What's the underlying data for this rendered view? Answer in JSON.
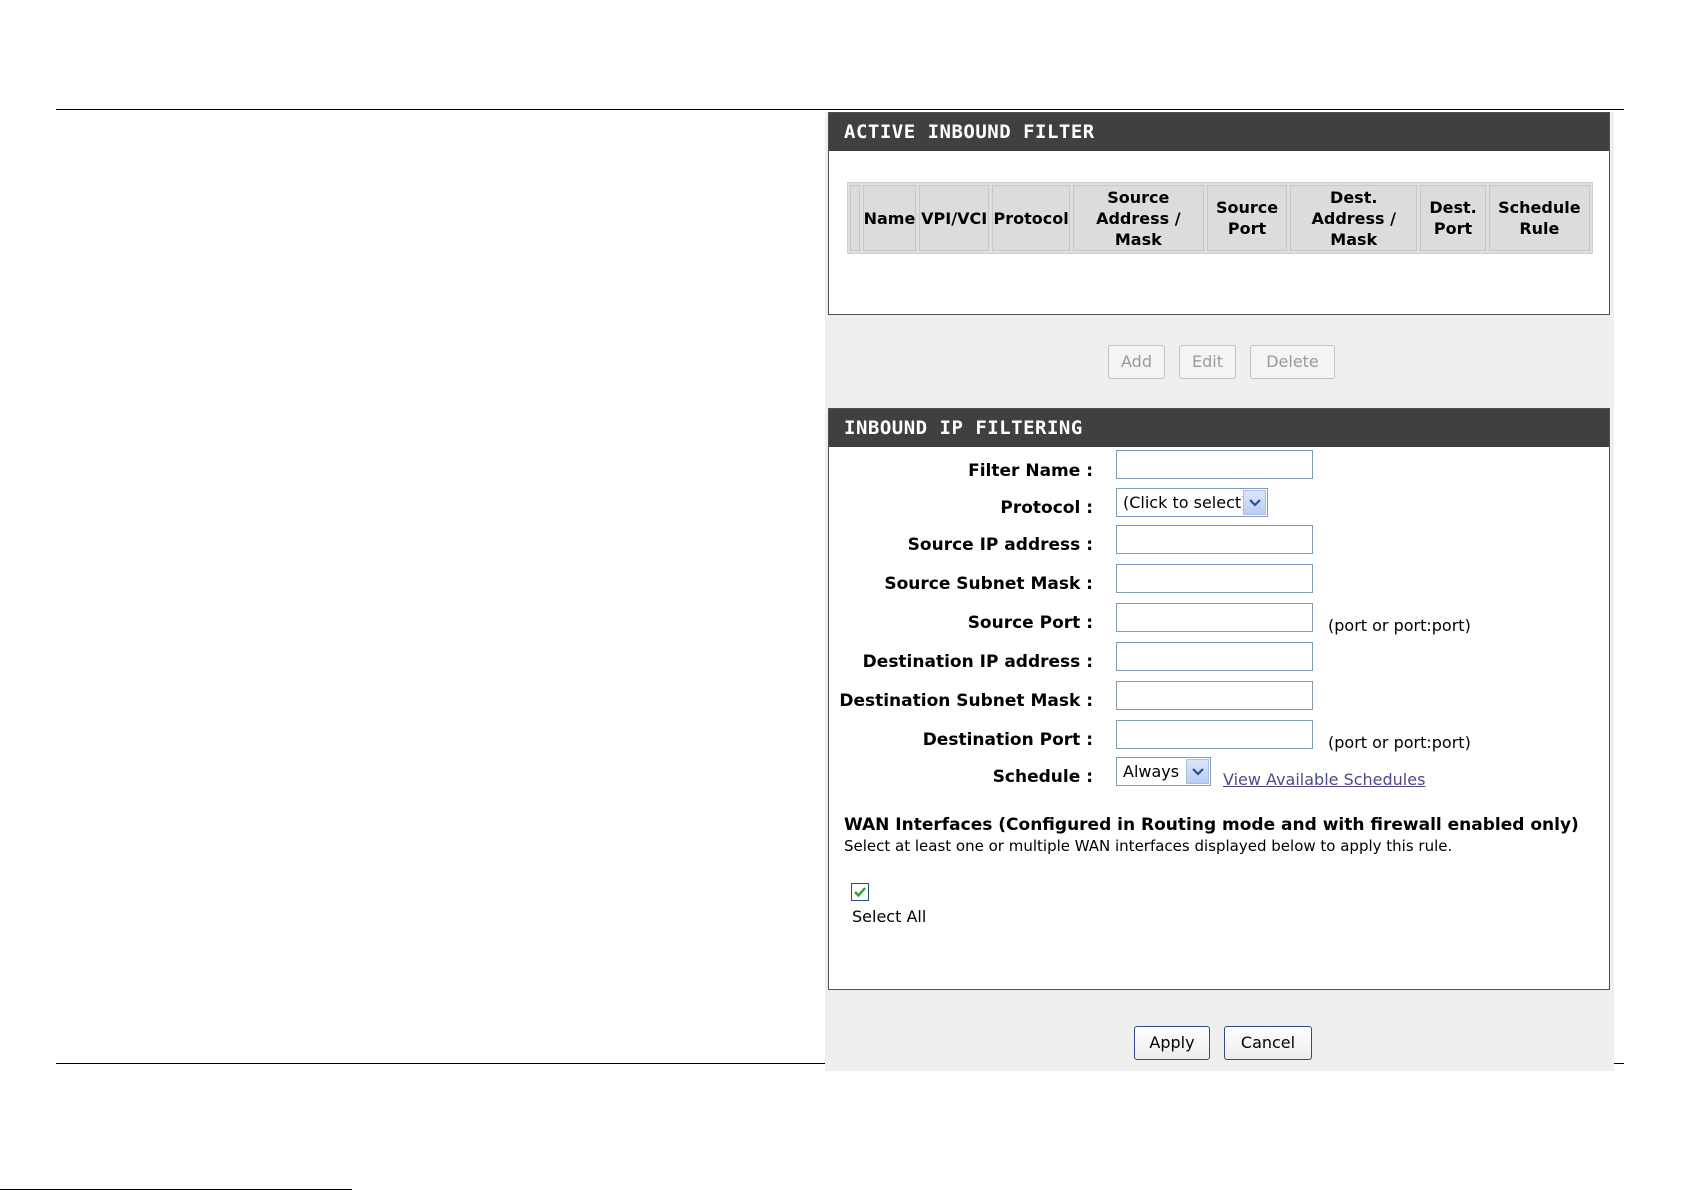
{
  "active_filter": {
    "header": "ACTIVE INBOUND FILTER",
    "columns": [
      "",
      "Name",
      "VPI/VCI",
      "Protocol",
      "Source\nAddress /\nMask",
      "Source\nPort",
      "Dest.\nAddress /\nMask",
      "Dest.\nPort",
      "Schedule\nRule"
    ]
  },
  "actions": {
    "add": "Add",
    "edit": "Edit",
    "delete": "Delete"
  },
  "inbound": {
    "header": "INBOUND IP FILTERING",
    "filter_name": {
      "label": "Filter Name :",
      "value": ""
    },
    "protocol": {
      "label": "Protocol :",
      "value": "(Click to select)"
    },
    "source_ip": {
      "label": "Source IP address :",
      "value": ""
    },
    "source_mask": {
      "label": "Source Subnet Mask :",
      "value": ""
    },
    "source_port": {
      "label": "Source Port :",
      "value": "",
      "hint": "(port or port:port)"
    },
    "dest_ip": {
      "label": "Destination IP address :",
      "value": ""
    },
    "dest_mask": {
      "label": "Destination Subnet Mask :",
      "value": ""
    },
    "dest_port": {
      "label": "Destination Port :",
      "value": "",
      "hint": "(port or port:port)"
    },
    "schedule": {
      "label": "Schedule :",
      "value": "Always",
      "link": "View Available Schedules"
    },
    "wan": {
      "title": "WAN Interfaces (Configured in Routing mode and with firewall enabled only)",
      "note": "Select at least one or multiple WAN interfaces displayed below to apply this rule.",
      "select_all_label": "Select All",
      "select_all_checked": true
    }
  },
  "footer_buttons": {
    "apply": "Apply",
    "cancel": "Cancel"
  },
  "colors": {
    "header_bg": "#404040",
    "panel_bg": "#efefef",
    "link": "#4a4a8c",
    "check": "#2e9e2e"
  }
}
